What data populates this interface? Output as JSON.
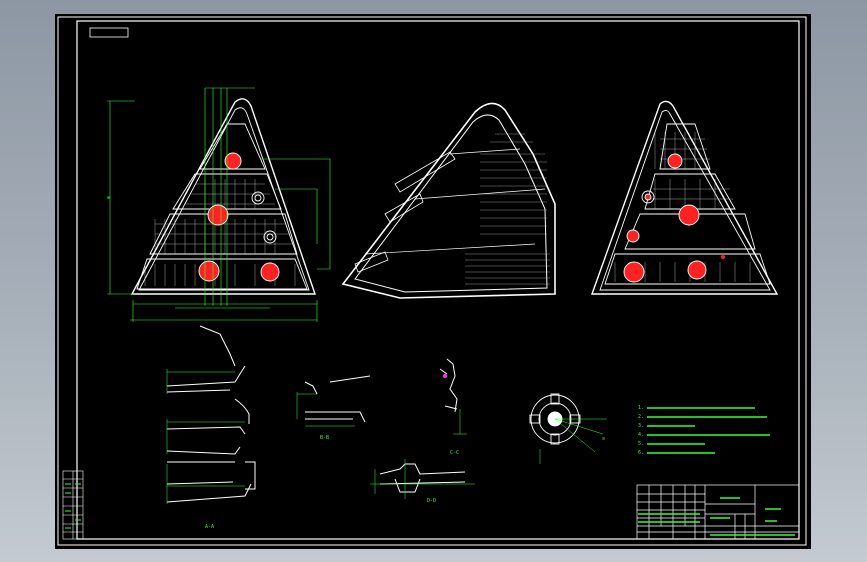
{
  "drawing": {
    "corner_tag": "",
    "title_block_name": "",
    "title_block_code": "",
    "tech_notes_title": "",
    "tech_notes": [
      "1.",
      "2.",
      "3.",
      "4.",
      "5.",
      "6."
    ],
    "section_labels": [
      "A-A",
      "B-B",
      "C-C",
      "D-D"
    ]
  },
  "colors": {
    "paper": "#000000",
    "geometry": "#ffffff",
    "dimension": "#33ff33",
    "hatch_fill": "#ff2222",
    "accent_magenta": "#ff33ff",
    "border": "#ffffff"
  }
}
